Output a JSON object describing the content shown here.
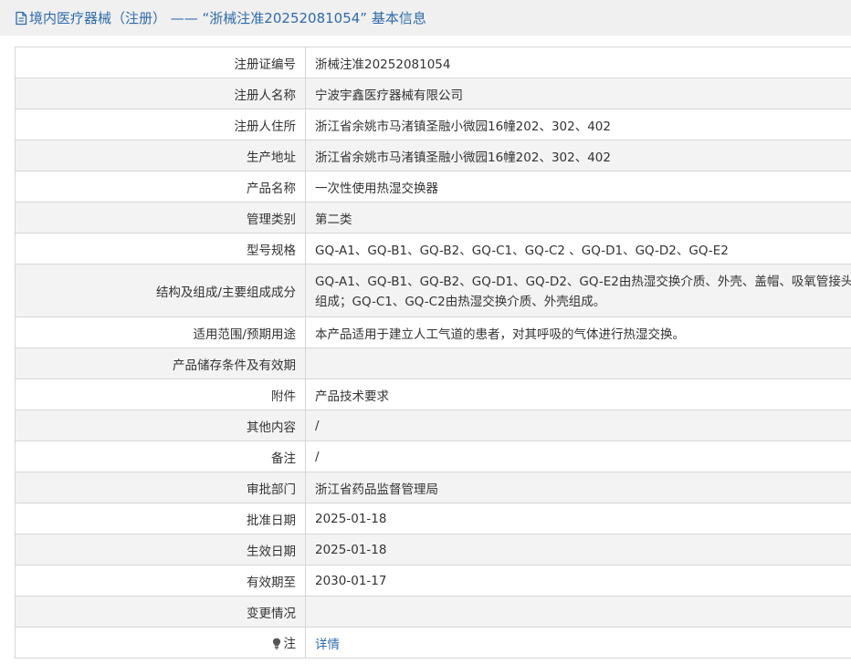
{
  "header": {
    "title": "境内医疗器械（注册） —— “浙械注准20252081054” 基本信息",
    "icon": "document-icon",
    "color": "#2f6bab"
  },
  "rows": [
    {
      "label": "注册证编号",
      "value": "浙械注准20252081054"
    },
    {
      "label": "注册人名称",
      "value": "宁波宇鑫医疗器械有限公司"
    },
    {
      "label": "注册人住所",
      "value": "浙江省余姚市马渚镇圣融小微园16幢202、302、402"
    },
    {
      "label": "生产地址",
      "value": "浙江省余姚市马渚镇圣融小微园16幢202、302、402"
    },
    {
      "label": "产品名称",
      "value": "一次性使用热湿交换器"
    },
    {
      "label": "管理类别",
      "value": "第二类"
    },
    {
      "label": "型号规格",
      "value": "GQ-A1、GQ-B1、GQ-B2、GQ-C1、GQ-C2 、GQ-D1、GQ-D2、GQ-E2"
    },
    {
      "label": "结构及组成/主要组成成分",
      "value": "GQ-A1、GQ-B1、GQ-B2、GQ-D1、GQ-D2、GQ-E2由热湿交换介质、外壳、盖帽、吸氧管接头组成；GQ-C1、GQ-C2由热湿交换介质、外壳组成。"
    },
    {
      "label": "适用范围/预期用途",
      "value": "本产品适用于建立人工气道的患者，对其呼吸的气体进行热湿交换。"
    },
    {
      "label": "产品储存条件及有效期",
      "value": ""
    },
    {
      "label": "附件",
      "value": "产品技术要求"
    },
    {
      "label": "其他内容",
      "value": "/"
    },
    {
      "label": "备注",
      "value": "/"
    },
    {
      "label": "审批部门",
      "value": "浙江省药品监督管理局"
    },
    {
      "label": "批准日期",
      "value": "2025-01-18"
    },
    {
      "label": "生效日期",
      "value": "2025-01-18"
    },
    {
      "label": "有效期至",
      "value": "2030-01-17"
    },
    {
      "label": "变更情况",
      "value": ""
    },
    {
      "label": "注",
      "value": "详情",
      "icon": "lightbulb-icon"
    }
  ]
}
